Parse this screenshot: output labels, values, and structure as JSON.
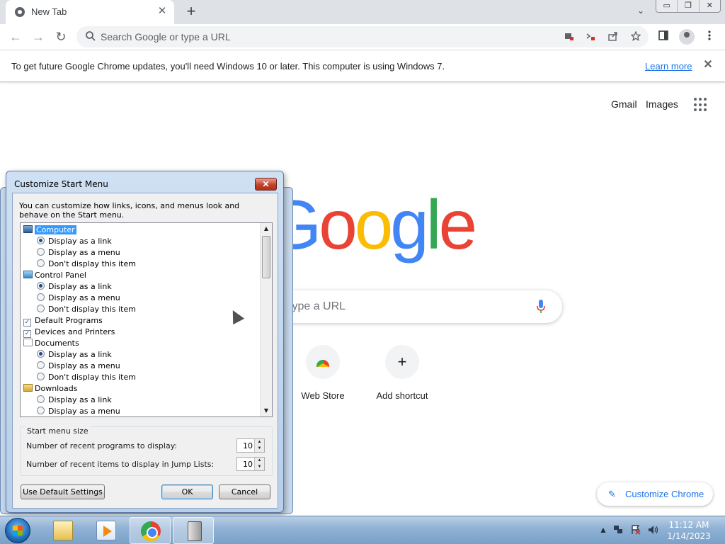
{
  "browser": {
    "tab_title": "New Tab",
    "tab_close_glyph": "✕",
    "new_tab_glyph": "+",
    "tab_search_glyph": "⌄",
    "window_controls": [
      "▭",
      "❐",
      "✕"
    ],
    "omnibox_placeholder": "Search Google or type a URL",
    "back_glyph": "←",
    "forward_glyph": "→",
    "reload_glyph": "↻",
    "omnibox_icons": [
      "camera-blocked-icon",
      "popup-blocked-icon",
      "share-icon",
      "bookmark-star-icon"
    ],
    "toolbar_icons": [
      "side-panel-icon",
      "profile-icon",
      "menu-icon"
    ]
  },
  "infobar": {
    "message": "To get future Google Chrome updates, you'll need Windows 10 or later. This computer is using Windows 7.",
    "learn_more": "Learn more",
    "close_glyph": "✕"
  },
  "ntp": {
    "gmail": "Gmail",
    "images": "Images",
    "logo_letters": [
      "G",
      "o",
      "o",
      "g",
      "l",
      "e"
    ],
    "logo_colors": [
      "#4285f4",
      "#ea4335",
      "#fbbc05",
      "#4285f4",
      "#34a853",
      "#ea4335"
    ],
    "search_placeholder": "type a URL",
    "shortcuts": [
      {
        "label": "Web Store",
        "icon": "web-store-icon"
      },
      {
        "label": "Add shortcut",
        "icon": "plus-icon",
        "glyph": "+"
      }
    ],
    "customize_label": "Customize Chrome",
    "customize_glyph": "✎"
  },
  "dialog": {
    "title": "Customize Start Menu",
    "close_glyph": "✕",
    "description": "You can customize how links, icons, and menus look and behave on the Start menu.",
    "tree": [
      {
        "kind": "header",
        "label": "Computer",
        "icon": "computer-icon",
        "selected": true
      },
      {
        "kind": "radio",
        "label": "Display as a link",
        "checked": true
      },
      {
        "kind": "radio",
        "label": "Display as a menu",
        "checked": false
      },
      {
        "kind": "radio",
        "label": "Don't display this item",
        "checked": false
      },
      {
        "kind": "header",
        "label": "Control Panel",
        "icon": "control-panel-icon"
      },
      {
        "kind": "radio",
        "label": "Display as a link",
        "checked": true
      },
      {
        "kind": "radio",
        "label": "Display as a menu",
        "checked": false
      },
      {
        "kind": "radio",
        "label": "Don't display this item",
        "checked": false
      },
      {
        "kind": "check",
        "label": "Default Programs",
        "checked": true
      },
      {
        "kind": "check",
        "label": "Devices and Printers",
        "checked": true
      },
      {
        "kind": "header",
        "label": "Documents",
        "icon": "documents-icon"
      },
      {
        "kind": "radio",
        "label": "Display as a link",
        "checked": true
      },
      {
        "kind": "radio",
        "label": "Display as a menu",
        "checked": false
      },
      {
        "kind": "radio",
        "label": "Don't display this item",
        "checked": false
      },
      {
        "kind": "header",
        "label": "Downloads",
        "icon": "downloads-icon"
      },
      {
        "kind": "radio",
        "label": "Display as a link",
        "checked": false
      },
      {
        "kind": "radio",
        "label": "Display as a menu",
        "checked": false
      }
    ],
    "size_group_label": "Start menu size",
    "recent_programs_label": "Number of recent programs to display:",
    "recent_programs_value": "10",
    "jump_list_label": "Number of recent items to display in Jump Lists:",
    "jump_list_value": "10",
    "default_settings": "Use Default Settings",
    "ok": "OK",
    "cancel": "Cancel"
  },
  "taskbar": {
    "pinned": [
      "windows-explorer-icon",
      "media-player-icon",
      "chrome-icon",
      "computer-tower-icon"
    ],
    "tray_icons": [
      "show-hidden-icons-icon",
      "network-icon",
      "action-center-flag-icon",
      "volume-icon"
    ],
    "tray_arrow": "▲",
    "time": "11:12 AM",
    "date": "1/14/2023"
  }
}
